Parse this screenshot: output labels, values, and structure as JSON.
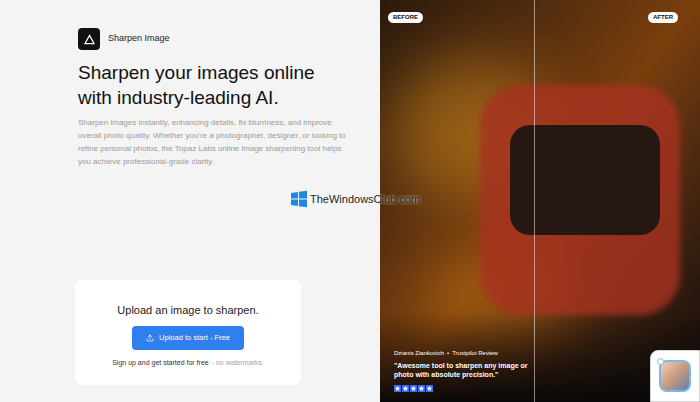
{
  "logo": {
    "label": "Sharpen Image"
  },
  "hero": {
    "title": "Sharpen your images online with industry-leading AI.",
    "description": "Sharpen images instantly, enhancing details, fix blurriness, and improve overall photo quality. Whether you're a photographer, designer, or looking to refine personal photos, the Topaz Labs online image sharpening tool helps you achieve professional-grade clarity."
  },
  "upload_card": {
    "title": "Upload an image to sharpen.",
    "button": "Upload to start - Free",
    "note": "Sign up and get started for free",
    "note_muted": "- no watermarks."
  },
  "comparison": {
    "before_label": "BEFORE",
    "after_label": "AFTER",
    "divider_level": 0.48
  },
  "review": {
    "author": "Dzianis Ziankovich",
    "separator": "•",
    "source": "Trustpilot Review",
    "quote": "\"Awesome tool to sharpen any image or photo with absolute precision.\"",
    "stars": 5
  },
  "watermark": {
    "text": "TheWindowsClub.com"
  }
}
